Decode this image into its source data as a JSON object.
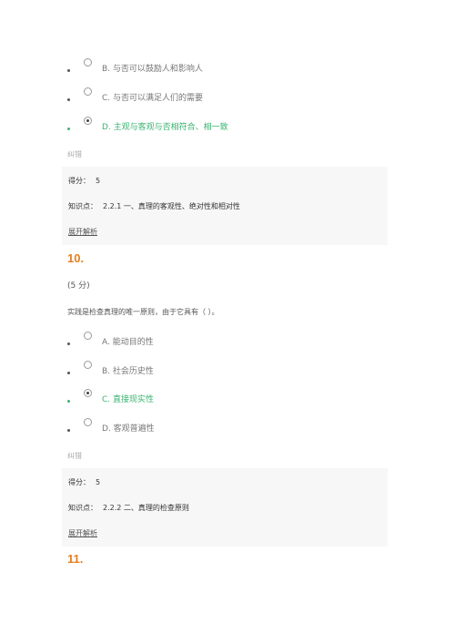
{
  "q9": {
    "options": [
      {
        "label": "B. 与否可以鼓励人和影响人",
        "selected": false,
        "correct": false
      },
      {
        "label": "C. 与否可以满足人们的需要",
        "selected": false,
        "correct": false
      },
      {
        "label": "D. 主观与客观与否相符合、相一致",
        "selected": true,
        "correct": true
      }
    ],
    "status": "纠错",
    "score_label": "得分：",
    "score_value": "5",
    "knowledge_label": "知识点：",
    "knowledge_value": "2.2.1 一、真理的客观性、绝对性和相对性",
    "expand": "展开解析"
  },
  "q10": {
    "number": "10.",
    "points": "(5 分)",
    "text": "实践是检查真理的唯一原则，由于它具有（ ）。",
    "options": [
      {
        "label": "A. 能动目的性",
        "selected": false,
        "correct": false
      },
      {
        "label": "B. 社会历史性",
        "selected": false,
        "correct": false
      },
      {
        "label": "C. 直接现实性",
        "selected": true,
        "correct": true
      },
      {
        "label": "D. 客观普遍性",
        "selected": false,
        "correct": false
      }
    ],
    "status": "纠错",
    "score_label": "得分：",
    "score_value": "5",
    "knowledge_label": "知识点：",
    "knowledge_value": "2.2.2 二、真理的检查原则",
    "expand": "展开解析"
  },
  "q11": {
    "number": "11."
  },
  "colors": {
    "correct": "#3cb371",
    "question_number": "#e67e22",
    "panel_bg": "#f7f7f7"
  }
}
